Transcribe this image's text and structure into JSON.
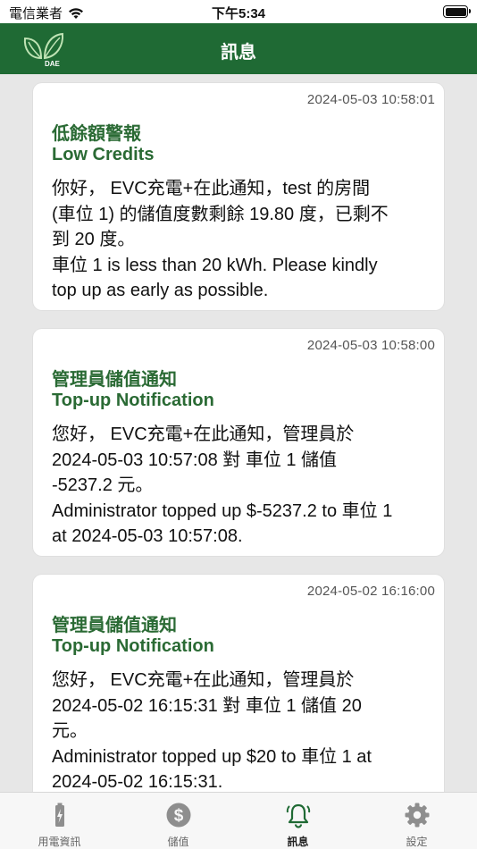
{
  "status_bar": {
    "carrier": "電信業者",
    "time": "下午5:34"
  },
  "header": {
    "title": "訊息",
    "logo_text": "DAE"
  },
  "messages": [
    {
      "timestamp": "2024-05-03 10:58:01",
      "title_zh": "低餘額警報",
      "title_en": "Low Credits",
      "body_lines": [
        "你好， EVC充電+在此通知，test 的房間",
        "(車位 1) 的儲值度數剩餘 19.80 度，已剩不",
        "到 20 度。",
        "車位 1 is less than 20 kWh. Please kindly",
        "top up as early as possible."
      ]
    },
    {
      "timestamp": "2024-05-03 10:58:00",
      "title_zh": "管理員儲值通知",
      "title_en": "Top-up Notification",
      "body_lines": [
        "您好， EVC充電+在此通知，管理員於",
        "2024-05-03 10:57:08 對 車位 1 儲值",
        "-5237.2 元。",
        "Administrator topped up $-5237.2 to 車位 1",
        "at 2024-05-03 10:57:08."
      ]
    },
    {
      "timestamp": "2024-05-02 16:16:00",
      "title_zh": "管理員儲值通知",
      "title_en": "Top-up Notification",
      "body_lines": [
        "您好， EVC充電+在此通知，管理員於",
        "2024-05-02 16:15:31 對 車位 1 儲值 20",
        "元。",
        "Administrator topped up $20 to 車位 1 at",
        "2024-05-02 16:15:31."
      ]
    }
  ],
  "tabs": [
    {
      "label": "用電資訊",
      "icon": "battery-icon",
      "active": false
    },
    {
      "label": "儲值",
      "icon": "dollar-icon",
      "active": false
    },
    {
      "label": "訊息",
      "icon": "bell-icon",
      "active": true
    },
    {
      "label": "設定",
      "icon": "gear-icon",
      "active": false
    }
  ],
  "colors": {
    "brand_green": "#1f6a34",
    "title_green": "#2a6a34",
    "background": "#e7e7e7"
  }
}
